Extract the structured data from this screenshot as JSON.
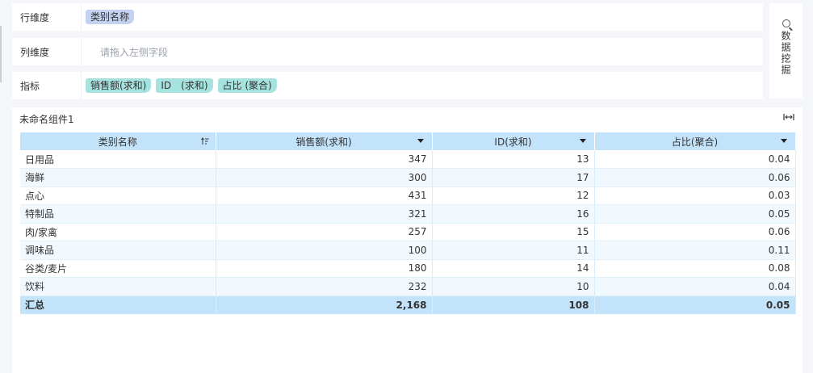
{
  "dimensions": {
    "row": {
      "label": "行维度",
      "fields": [
        "类别名称"
      ]
    },
    "column": {
      "label": "列维度",
      "placeholder": "请拖入左侧字段"
    },
    "metrics": {
      "label": "指标",
      "fields": [
        "销售额(求和)",
        "ID　(求和)",
        "占比 (聚合)"
      ]
    }
  },
  "mining": {
    "label": "数据挖掘",
    "icon": "search-icon"
  },
  "component": {
    "title": "未命名组件1",
    "expand_icon": "fit-width-icon"
  },
  "table": {
    "headers": [
      "类别名称",
      "销售额(求和)",
      "ID(求和)",
      "占比(聚合)"
    ],
    "rows": [
      [
        "日用品",
        "347",
        "13",
        "0.04"
      ],
      [
        "海鲜",
        "300",
        "17",
        "0.06"
      ],
      [
        "点心",
        "431",
        "12",
        "0.03"
      ],
      [
        "特制品",
        "321",
        "16",
        "0.05"
      ],
      [
        "肉/家禽",
        "257",
        "15",
        "0.06"
      ],
      [
        "调味品",
        "100",
        "11",
        "0.11"
      ],
      [
        "谷类/麦片",
        "180",
        "14",
        "0.08"
      ],
      [
        "饮料",
        "232",
        "10",
        "0.04"
      ]
    ],
    "total": [
      "汇总",
      "2,168",
      "108",
      "0.05"
    ]
  },
  "colors": {
    "dim_pill": "#c3d2f0",
    "metric_pill": "#a6e3df",
    "table_header": "#c3e3fb",
    "row_alt": "#f2f9fe"
  }
}
